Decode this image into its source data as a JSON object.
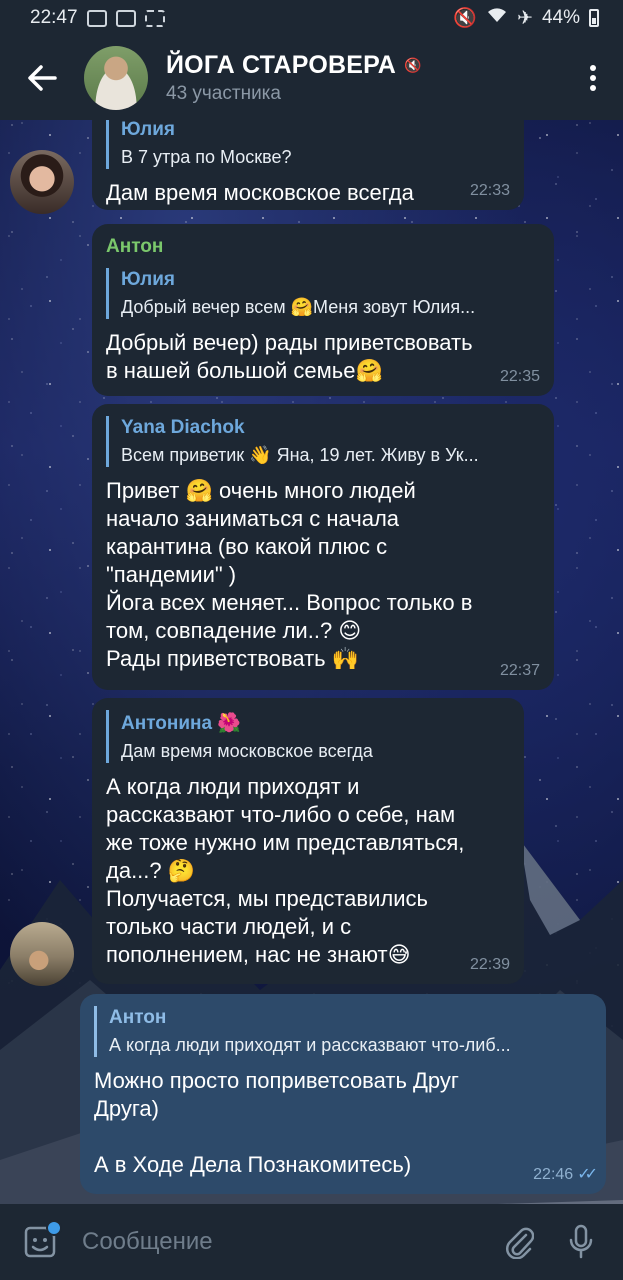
{
  "status_bar": {
    "time": "22:47",
    "battery": "44%"
  },
  "header": {
    "title": "ЙОГА СТАРОВЕРА",
    "subtitle": "43 участника"
  },
  "messages": [
    {
      "reply_name": "Юлия",
      "reply_text": "В 7 утра по Москве?",
      "text": "Дам время московское всегда",
      "time": "22:33"
    },
    {
      "sender": "Антон",
      "sender_color": "#7bc86c",
      "reply_name": "Юлия",
      "reply_text": "Добрый вечер всем 🤗Меня зовут Юлия...",
      "text": "Добрый вечер) рады приветсвовать\nв нашей большой семье🤗",
      "time": "22:35"
    },
    {
      "reply_name": "Yana Diachok",
      "reply_text": "Всем приветик 👋 Яна, 19 лет. Живу в Ук...",
      "text": "Привет 🤗 очень много людей\nначало заниматься с начала\nкарантина (во какой плюс с\n\"пандемии\" )\nЙога всех меняет... Вопрос только в\nтом, совпадение ли..? 😊\nРады приветствовать 🙌",
      "time": "22:37"
    },
    {
      "reply_name": "Антонина 🌺",
      "reply_text": "Дам время московское всегда",
      "text": "А когда люди приходят и\nрассказвают что-либо о себе, нам\nже тоже нужно им представляться,\nда...? 🤔\nПолучается, мы представились\nтолько части людей, и с\nпополнением, нас не знают😅",
      "time": "22:39"
    },
    {
      "reply_name": "Антон",
      "reply_text": "А когда люди приходят и рассказвают что-либ...",
      "text": "Можно просто поприветсовать Друг\nДруга)\n\nА в Ходе Дела Познакомитесь)",
      "time": "22:46"
    }
  ],
  "input": {
    "placeholder": "Сообщение"
  },
  "colors": {
    "bar_bg": "#1d2733",
    "bubble_in": "#1d2733",
    "bubble_out": "#2d4a6a",
    "accent": "#6ea8dc",
    "sender_green": "#7bc86c"
  }
}
